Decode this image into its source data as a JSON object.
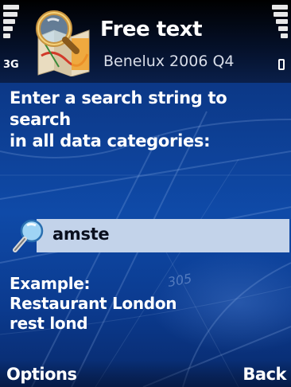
{
  "status_bar": {
    "network_label": "3G",
    "signal_bars": 5,
    "battery_bars": 5
  },
  "header": {
    "title": "Free text",
    "subtitle": "Benelux 2006 Q4",
    "app_icon": "map-search-app-icon"
  },
  "main": {
    "prompt_line1": "Enter a search string to search",
    "prompt_line2": "in all data categories:",
    "search": {
      "icon": "magnifier-icon",
      "value": "amste"
    },
    "example_heading": "Example:",
    "example_line1": "Restaurant London",
    "example_line2": "rest lond",
    "map_label": "305"
  },
  "softkeys": {
    "left": "Options",
    "right": "Back"
  },
  "colors": {
    "background_top": "#0a2b6a",
    "background_mid": "#0f4aa8",
    "search_field": "#c3d3ea",
    "text": "#ffffff"
  }
}
